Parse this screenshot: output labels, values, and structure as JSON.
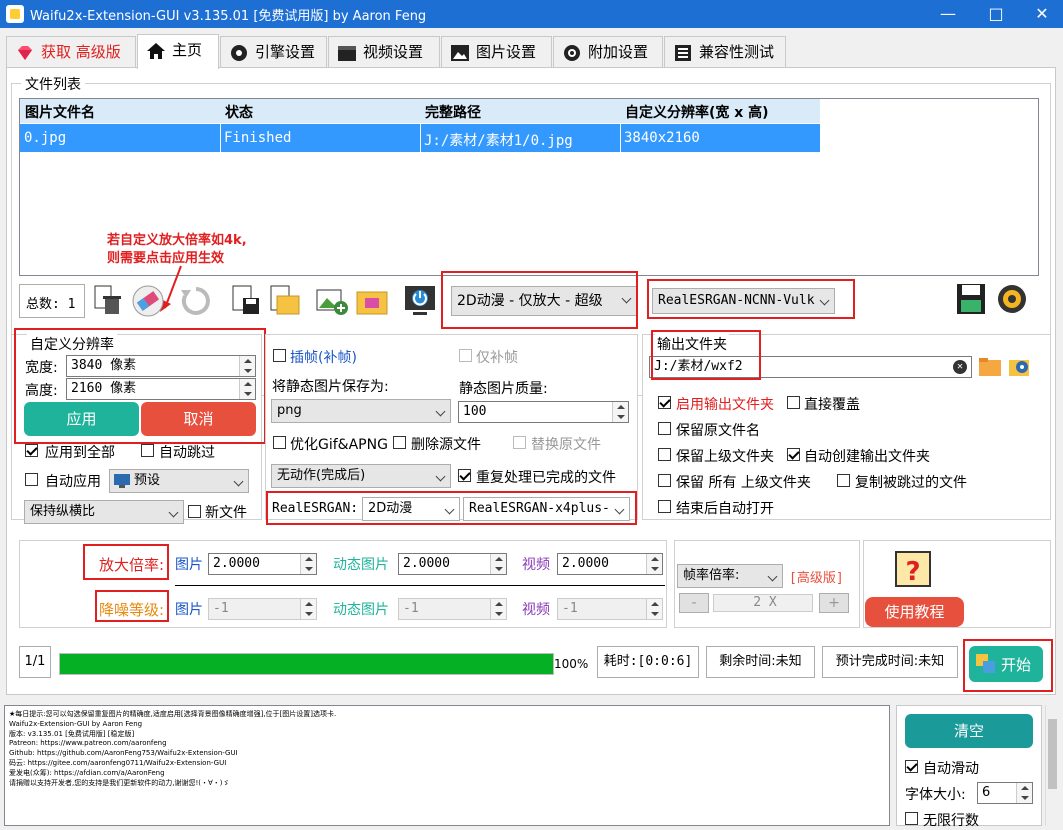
{
  "window": {
    "title": "Waifu2x-Extension-GUI v3.135.01 [免费试用版] by Aaron Feng"
  },
  "tabs": [
    {
      "label": "获取 高级版"
    },
    {
      "label": "主页"
    },
    {
      "label": "引擎设置"
    },
    {
      "label": "视频设置"
    },
    {
      "label": "图片设置"
    },
    {
      "label": "附加设置"
    },
    {
      "label": "兼容性测试"
    }
  ],
  "file_list": {
    "group_title": "文件列表",
    "columns": [
      "图片文件名",
      "状态",
      "完整路径",
      "自定义分辨率(宽 x 高)"
    ],
    "rows": [
      [
        "0.jpg",
        "Finished",
        "J:/素材/素材1/0.jpg",
        "3840x2160"
      ]
    ],
    "total_label": "总数: 1"
  },
  "hint": {
    "line1": "若自定义放大倍率如4k,",
    "line2": "则需要点击应用生效"
  },
  "model_combo": "2D动漫 - 仅放大 - 超级",
  "engine_combo": "RealESRGAN-NCNN-Vulk",
  "custom_res": {
    "title": "自定义分辨率",
    "width_label": "宽度:",
    "width_value": "3840 像素",
    "height_label": "高度:",
    "height_value": "2160 像素",
    "apply": "应用",
    "cancel": "取消",
    "apply_all": "应用到全部",
    "auto_skip": "自动跳过",
    "auto_apply": "自动应用",
    "preset": "预设",
    "aspect": "保持纵横比",
    "new_file": "新文件"
  },
  "middle": {
    "interp": "插帧(补帧)",
    "interp_only": "仅补帧",
    "save_as_label": "将静态图片保存为:",
    "format": "png",
    "quality_label": "静态图片质量:",
    "quality": "100",
    "optimize_gif": "优化Gif&APNG",
    "delete_source": "删除源文件",
    "replace_source": "替换原文件",
    "after_action": "无动作(完成后)",
    "reprocess": "重复处理已完成的文件",
    "realesrgan_label": "RealESRGAN:",
    "realesrgan_model": "2D动漫",
    "realesrgan_variant": "RealESRGAN-x4plus-"
  },
  "output": {
    "title": "输出文件夹",
    "path": "J:/素材/wxf2",
    "enable": "启用输出文件夹",
    "overwrite": "直接覆盖",
    "keep_name": "保留原文件名",
    "keep_parent": "保留上级文件夹",
    "auto_create": "自动创建输出文件夹",
    "keep_all_parent": "保留 所有 上级文件夹",
    "copy_skipped": "复制被跳过的文件",
    "open_after": "结束后自动打开"
  },
  "scale": {
    "label": "放大倍率:",
    "image_label": "图片",
    "image_value": "2.0000",
    "gif_label": "动态图片",
    "gif_value": "2.0000",
    "video_label": "视频",
    "video_value": "2.0000"
  },
  "denoise": {
    "label": "降噪等级:",
    "image_label": "图片",
    "image_value": "-1",
    "gif_label": "动态图片",
    "gif_value": "-1",
    "video_label": "视频",
    "video_value": "-1"
  },
  "frame_rate": {
    "label": "帧率倍率:",
    "advanced": "[高级版]",
    "minus": "-",
    "value": "2 X",
    "plus": "+"
  },
  "tutorial_button": "使用教程",
  "progress": {
    "count": "1/1",
    "percent_value": 100,
    "percent": "100%",
    "elapsed": "耗时:[0:0:6]",
    "remaining": "剩余时间:未知",
    "eta": "预计完成时间:未知",
    "start": "开始"
  },
  "log": {
    "lines": [
      "★每日提示:您可以勾选保留重复图片的精确度,适度启用[选择背景图像精确度增强],位于[图片设置]选项卡.",
      "Waifu2x-Extension-GUI by Aaron Feng",
      "版本: v3.135.01 [免费试用版] [稳定版]",
      "Patreon: https://www.patreon.com/aaronfeng",
      "Github: https://github.com/AaronFeng753/Waifu2x-Extension-GUI",
      "码云: https://gitee.com/aaronfeng0711/Waifu2x-Extension-GUI",
      "爱发电(众筹): https://afdian.com/a/AaronFeng",
      "请捐赠以支持开发者,您的支持是我们更新软件的动力,谢谢您!(・∀・)ゞ"
    ]
  },
  "log_side": {
    "clear": "清空",
    "auto_scroll": "自动滑动",
    "font_size_label": "字体大小:",
    "font_size": "6",
    "unlimited": "无限行数"
  },
  "colors": {
    "accent": "#1eb39a",
    "danger": "#e8503e",
    "progress": "#06b025",
    "title_bar": "#1e6fd4"
  }
}
